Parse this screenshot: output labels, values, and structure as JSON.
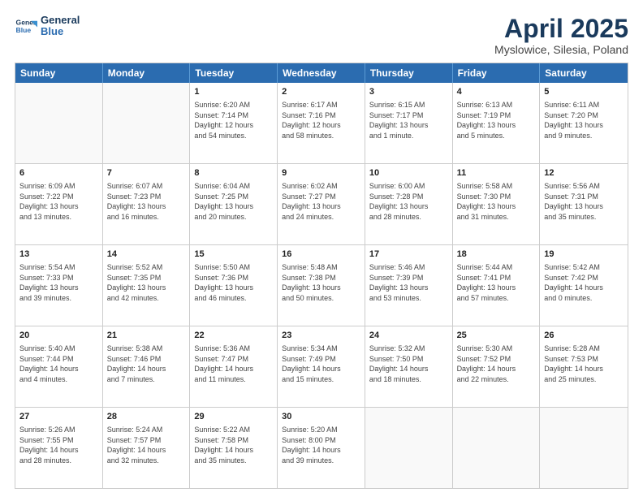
{
  "header": {
    "logo_line1": "General",
    "logo_line2": "Blue",
    "title": "April 2025",
    "location": "Myslowice, Silesia, Poland"
  },
  "weekdays": [
    "Sunday",
    "Monday",
    "Tuesday",
    "Wednesday",
    "Thursday",
    "Friday",
    "Saturday"
  ],
  "rows": [
    [
      {
        "day": "",
        "info": ""
      },
      {
        "day": "",
        "info": ""
      },
      {
        "day": "1",
        "info": "Sunrise: 6:20 AM\nSunset: 7:14 PM\nDaylight: 12 hours\nand 54 minutes."
      },
      {
        "day": "2",
        "info": "Sunrise: 6:17 AM\nSunset: 7:16 PM\nDaylight: 12 hours\nand 58 minutes."
      },
      {
        "day": "3",
        "info": "Sunrise: 6:15 AM\nSunset: 7:17 PM\nDaylight: 13 hours\nand 1 minute."
      },
      {
        "day": "4",
        "info": "Sunrise: 6:13 AM\nSunset: 7:19 PM\nDaylight: 13 hours\nand 5 minutes."
      },
      {
        "day": "5",
        "info": "Sunrise: 6:11 AM\nSunset: 7:20 PM\nDaylight: 13 hours\nand 9 minutes."
      }
    ],
    [
      {
        "day": "6",
        "info": "Sunrise: 6:09 AM\nSunset: 7:22 PM\nDaylight: 13 hours\nand 13 minutes."
      },
      {
        "day": "7",
        "info": "Sunrise: 6:07 AM\nSunset: 7:23 PM\nDaylight: 13 hours\nand 16 minutes."
      },
      {
        "day": "8",
        "info": "Sunrise: 6:04 AM\nSunset: 7:25 PM\nDaylight: 13 hours\nand 20 minutes."
      },
      {
        "day": "9",
        "info": "Sunrise: 6:02 AM\nSunset: 7:27 PM\nDaylight: 13 hours\nand 24 minutes."
      },
      {
        "day": "10",
        "info": "Sunrise: 6:00 AM\nSunset: 7:28 PM\nDaylight: 13 hours\nand 28 minutes."
      },
      {
        "day": "11",
        "info": "Sunrise: 5:58 AM\nSunset: 7:30 PM\nDaylight: 13 hours\nand 31 minutes."
      },
      {
        "day": "12",
        "info": "Sunrise: 5:56 AM\nSunset: 7:31 PM\nDaylight: 13 hours\nand 35 minutes."
      }
    ],
    [
      {
        "day": "13",
        "info": "Sunrise: 5:54 AM\nSunset: 7:33 PM\nDaylight: 13 hours\nand 39 minutes."
      },
      {
        "day": "14",
        "info": "Sunrise: 5:52 AM\nSunset: 7:35 PM\nDaylight: 13 hours\nand 42 minutes."
      },
      {
        "day": "15",
        "info": "Sunrise: 5:50 AM\nSunset: 7:36 PM\nDaylight: 13 hours\nand 46 minutes."
      },
      {
        "day": "16",
        "info": "Sunrise: 5:48 AM\nSunset: 7:38 PM\nDaylight: 13 hours\nand 50 minutes."
      },
      {
        "day": "17",
        "info": "Sunrise: 5:46 AM\nSunset: 7:39 PM\nDaylight: 13 hours\nand 53 minutes."
      },
      {
        "day": "18",
        "info": "Sunrise: 5:44 AM\nSunset: 7:41 PM\nDaylight: 13 hours\nand 57 minutes."
      },
      {
        "day": "19",
        "info": "Sunrise: 5:42 AM\nSunset: 7:42 PM\nDaylight: 14 hours\nand 0 minutes."
      }
    ],
    [
      {
        "day": "20",
        "info": "Sunrise: 5:40 AM\nSunset: 7:44 PM\nDaylight: 14 hours\nand 4 minutes."
      },
      {
        "day": "21",
        "info": "Sunrise: 5:38 AM\nSunset: 7:46 PM\nDaylight: 14 hours\nand 7 minutes."
      },
      {
        "day": "22",
        "info": "Sunrise: 5:36 AM\nSunset: 7:47 PM\nDaylight: 14 hours\nand 11 minutes."
      },
      {
        "day": "23",
        "info": "Sunrise: 5:34 AM\nSunset: 7:49 PM\nDaylight: 14 hours\nand 15 minutes."
      },
      {
        "day": "24",
        "info": "Sunrise: 5:32 AM\nSunset: 7:50 PM\nDaylight: 14 hours\nand 18 minutes."
      },
      {
        "day": "25",
        "info": "Sunrise: 5:30 AM\nSunset: 7:52 PM\nDaylight: 14 hours\nand 22 minutes."
      },
      {
        "day": "26",
        "info": "Sunrise: 5:28 AM\nSunset: 7:53 PM\nDaylight: 14 hours\nand 25 minutes."
      }
    ],
    [
      {
        "day": "27",
        "info": "Sunrise: 5:26 AM\nSunset: 7:55 PM\nDaylight: 14 hours\nand 28 minutes."
      },
      {
        "day": "28",
        "info": "Sunrise: 5:24 AM\nSunset: 7:57 PM\nDaylight: 14 hours\nand 32 minutes."
      },
      {
        "day": "29",
        "info": "Sunrise: 5:22 AM\nSunset: 7:58 PM\nDaylight: 14 hours\nand 35 minutes."
      },
      {
        "day": "30",
        "info": "Sunrise: 5:20 AM\nSunset: 8:00 PM\nDaylight: 14 hours\nand 39 minutes."
      },
      {
        "day": "",
        "info": ""
      },
      {
        "day": "",
        "info": ""
      },
      {
        "day": "",
        "info": ""
      }
    ]
  ]
}
